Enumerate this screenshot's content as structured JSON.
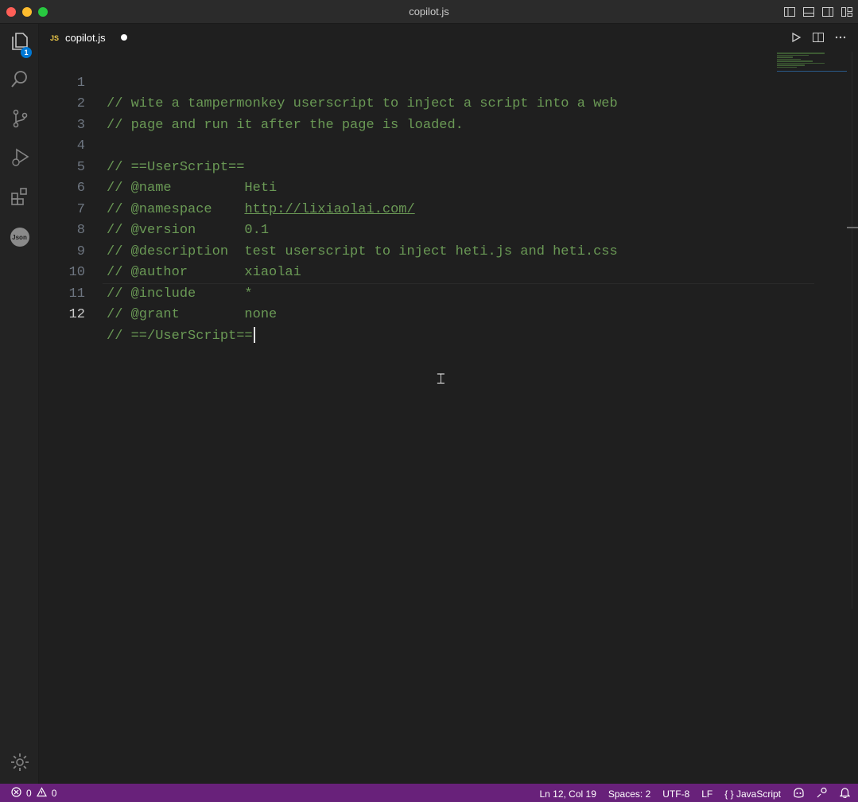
{
  "window": {
    "title": "copilot.js"
  },
  "activity_bar": {
    "explorer_badge": "1",
    "json_label": "Json"
  },
  "tab": {
    "lang_label": "JS",
    "file_name": "copilot.js"
  },
  "editor": {
    "lines": [
      {
        "number": "1",
        "text": "// wite a tampermonkey userscript to inject a script into a web"
      },
      {
        "number": "2",
        "text": "// page and run it after the page is loaded."
      },
      {
        "number": "3",
        "text": ""
      },
      {
        "number": "4",
        "text": "// ==UserScript=="
      },
      {
        "number": "5",
        "text": "// @name         Heti"
      },
      {
        "number": "6",
        "text_prefix": "// @namespace    ",
        "url": "http://lixiaolai.com/"
      },
      {
        "number": "7",
        "text": "// @version      0.1"
      },
      {
        "number": "8",
        "text": "// @description  test userscript to inject heti.js and heti.css"
      },
      {
        "number": "9",
        "text": "// @author       xiaolai"
      },
      {
        "number": "10",
        "text": "// @include      *"
      },
      {
        "number": "11",
        "text": "// @grant        none"
      },
      {
        "number": "12",
        "text": "// ==/UserScript=="
      }
    ]
  },
  "status_bar": {
    "errors": "0",
    "warnings": "0",
    "position": "Ln 12, Col 19",
    "spaces": "Spaces: 2",
    "encoding": "UTF-8",
    "eol": "LF",
    "language_braces": "{ }",
    "language": "JavaScript"
  },
  "colors": {
    "status_bar": "#68217a",
    "comment": "#6a9955",
    "badge": "#0078d4"
  }
}
